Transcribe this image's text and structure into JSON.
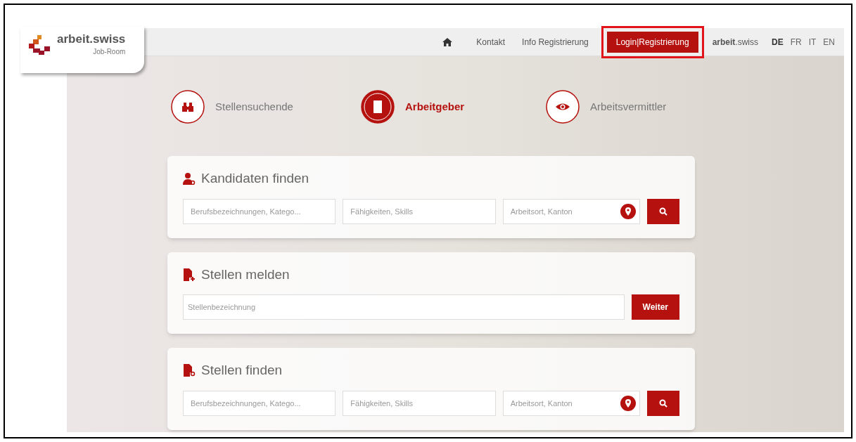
{
  "logo": {
    "name": "arbeit.swiss",
    "subtitle": "Job-Room"
  },
  "nav": {
    "items": [
      {
        "kind": "home"
      },
      {
        "kind": "link",
        "label": "Kontakt",
        "highlighted": false
      },
      {
        "kind": "link",
        "label": "Info Registrierung",
        "highlighted": false
      },
      {
        "kind": "button",
        "label": "Login|Registrierung",
        "highlighted": true
      }
    ],
    "brand": {
      "bold": "arbeit",
      "rest": ".swiss"
    },
    "languages": [
      {
        "label": "DE",
        "selected": true
      },
      {
        "label": "FR",
        "selected": false
      },
      {
        "label": "IT",
        "selected": false
      },
      {
        "label": "EN",
        "selected": false
      }
    ]
  },
  "roles": [
    {
      "label": "Stellensuchende",
      "selected": false
    },
    {
      "label": "Arbeitgeber",
      "selected": true
    },
    {
      "label": "Arbeitsvermittler",
      "selected": false
    }
  ],
  "sections": [
    {
      "kind": "search",
      "title": "Kandidaten finden",
      "fields": [
        {
          "placeholder": "Berufsbezeichnungen, Katego..."
        },
        {
          "placeholder": "Fähigkeiten, Skills"
        },
        {
          "placeholder": "Arbeitsort, Kanton"
        }
      ]
    },
    {
      "kind": "report",
      "title": "Stellen melden",
      "fields": [
        {
          "placeholder": "Stellenbezeichnung"
        }
      ],
      "button": "Weiter"
    },
    {
      "kind": "search",
      "title": "Stellen finden",
      "fields": [
        {
          "placeholder": "Berufsbezeichnungen, Katego..."
        },
        {
          "placeholder": "Fähigkeiten, Skills"
        },
        {
          "placeholder": "Arbeitsort, Kanton"
        }
      ]
    }
  ]
}
